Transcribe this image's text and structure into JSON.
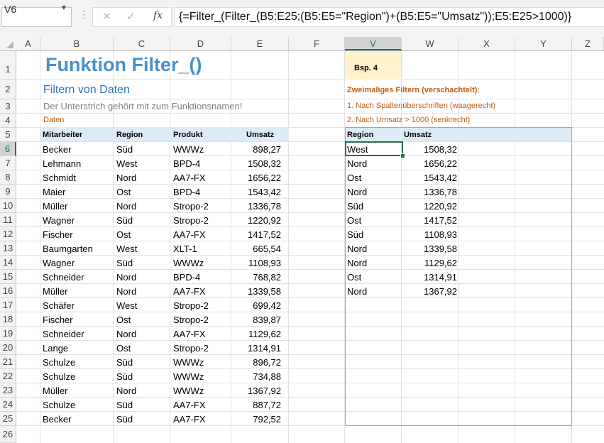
{
  "formula_bar": {
    "name_box": "V6",
    "cancel_icon": "✕",
    "enter_icon": "✓",
    "fx_label": "fx",
    "formula": "{=Filter_(Filter_(B5:E25;(B5:E5=\"Region\")+(B5:E5=\"Umsatz\"));E5:E25>1000)}"
  },
  "columns": [
    "A",
    "B",
    "C",
    "D",
    "E",
    "F",
    "V",
    "W",
    "X",
    "Y",
    "Z"
  ],
  "selected_column": "V",
  "rows": [
    "1",
    "2",
    "3",
    "4",
    "5",
    "6",
    "7",
    "8",
    "9",
    "10",
    "11",
    "12",
    "13",
    "14",
    "15",
    "16",
    "17",
    "18",
    "19",
    "20",
    "21",
    "22",
    "23",
    "24",
    "25",
    "26"
  ],
  "selected_row": "6",
  "sheet": {
    "title": "Funktion Filter_()",
    "subtitle": "Filtern von Daten",
    "note": "Der Unterstrich gehört mit zum Funktionsnamen!",
    "data_label": "Daten",
    "example_label": "Bsp. 4",
    "desc_heading": "Zweimaliges Filtern (verschachtelt):",
    "desc_step1": "1.  Nach Spaltenüberschriften (waagerecht)",
    "desc_step2": "2.  Nach Umsatz > 1000  (senkrecht)"
  },
  "source_table": {
    "headers": [
      "Mitarbeiter",
      "Region",
      "Produkt",
      "Umsatz"
    ],
    "rows": [
      [
        "Becker",
        "Süd",
        "WWWz",
        "898,27"
      ],
      [
        "Lehmann",
        "West",
        "BPD-4",
        "1508,32"
      ],
      [
        "Schmidt",
        "Nord",
        "AA7-FX",
        "1656,22"
      ],
      [
        "Maier",
        "Ost",
        "BPD-4",
        "1543,42"
      ],
      [
        "Müller",
        "Nord",
        "Stropo-2",
        "1336,78"
      ],
      [
        "Wagner",
        "Süd",
        "Stropo-2",
        "1220,92"
      ],
      [
        "Fischer",
        "Ost",
        "AA7-FX",
        "1417,52"
      ],
      [
        "Baumgarten",
        "West",
        "XLT-1",
        "665,54"
      ],
      [
        "Wagner",
        "Süd",
        "WWWz",
        "1108,93"
      ],
      [
        "Schneider",
        "Nord",
        "BPD-4",
        "768,82"
      ],
      [
        "Müller",
        "Nord",
        "AA7-FX",
        "1339,58"
      ],
      [
        "Schäfer",
        "West",
        "Stropo-2",
        "699,42"
      ],
      [
        "Fischer",
        "Ost",
        "Stropo-2",
        "839,87"
      ],
      [
        "Schneider",
        "Nord",
        "AA7-FX",
        "1129,62"
      ],
      [
        "Lange",
        "Ost",
        "Stropo-2",
        "1314,91"
      ],
      [
        "Schulze",
        "Süd",
        "WWWz",
        "896,72"
      ],
      [
        "Schulze",
        "Süd",
        "WWWz",
        "734,88"
      ],
      [
        "Müller",
        "Nord",
        "WWWz",
        "1367,92"
      ],
      [
        "Schulze",
        "Süd",
        "AA7-FX",
        "887,72"
      ],
      [
        "Becker",
        "Süd",
        "AA7-FX",
        "792,52"
      ]
    ]
  },
  "result_table": {
    "headers": [
      "Region",
      "Umsatz"
    ],
    "rows": [
      [
        "West",
        "1508,32"
      ],
      [
        "Nord",
        "1656,22"
      ],
      [
        "Ost",
        "1543,42"
      ],
      [
        "Nord",
        "1336,78"
      ],
      [
        "Süd",
        "1220,92"
      ],
      [
        "Ost",
        "1417,52"
      ],
      [
        "Süd",
        "1108,93"
      ],
      [
        "Nord",
        "1339,58"
      ],
      [
        "Nord",
        "1129,62"
      ],
      [
        "Ost",
        "1314,91"
      ],
      [
        "Nord",
        "1367,92"
      ]
    ]
  }
}
